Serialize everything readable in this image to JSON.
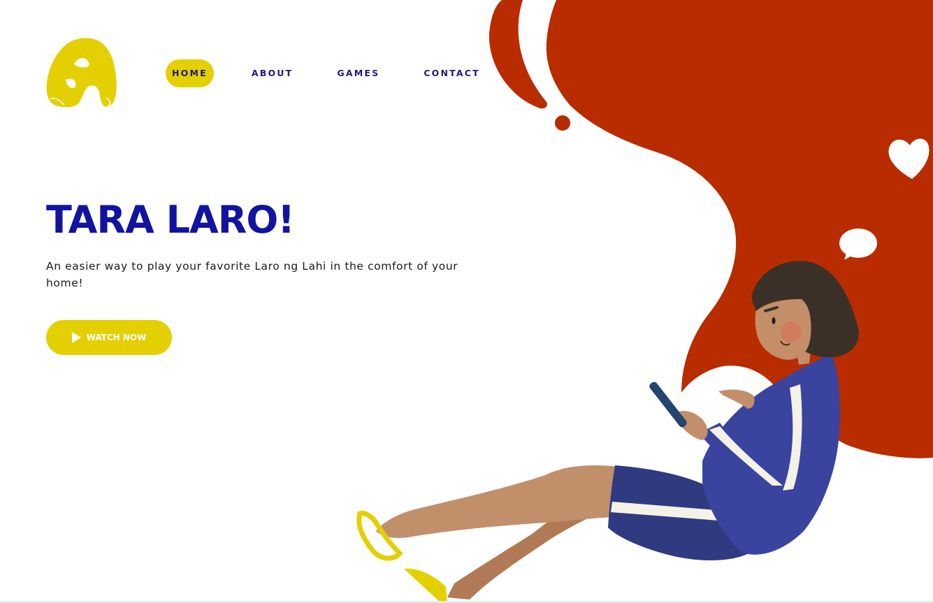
{
  "nav": {
    "items": [
      {
        "label": "HOME",
        "active": true
      },
      {
        "label": "ABOUT",
        "active": false
      },
      {
        "label": "GAMES",
        "active": false
      },
      {
        "label": "CONTACT",
        "active": false
      }
    ]
  },
  "hero": {
    "title": "TARA LARO!",
    "subtitle": "An easier way to play your favorite Laro ng Lahi in the comfort of your home!",
    "cta_label": "WATCH NOW"
  },
  "icons": {
    "logo": "letter-a-brush-logo",
    "play": "play-icon",
    "heart": "heart-icon",
    "chat": "speech-bubble-icon"
  },
  "colors": {
    "accent_yellow": "#e4d000",
    "brand_blue": "#12139f",
    "nav_text": "#1d1a7a",
    "blob_red": "#b82c00",
    "jacket_blue": "#3a449e"
  }
}
